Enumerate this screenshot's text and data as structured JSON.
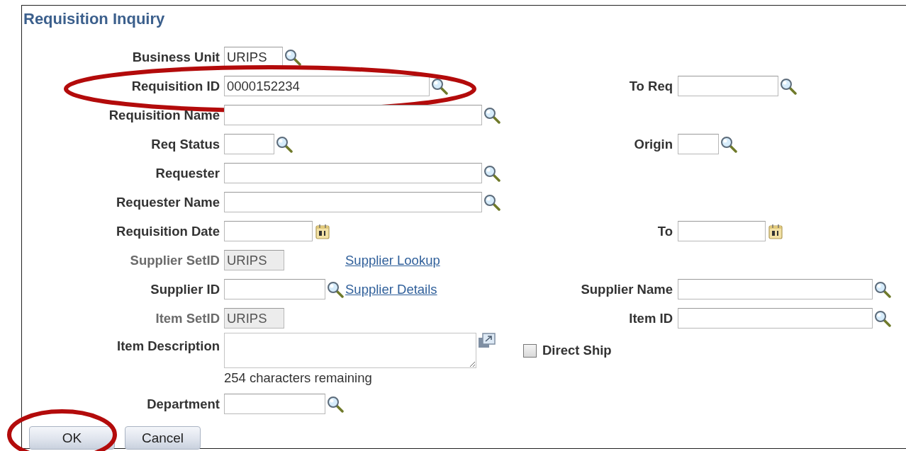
{
  "title": "Requisition Inquiry",
  "rows": [
    {
      "label": "Business Unit",
      "field": {
        "kind": "input",
        "value": "URIPS",
        "icon": {
          "kind": "search"
        }
      }
    },
    {
      "label": "Requisition ID",
      "circled": true,
      "field": {
        "kind": "input",
        "value": "0000152234",
        "icon": {
          "kind": "search"
        }
      },
      "right": {
        "kind": "input",
        "label": "To Req",
        "icon": {
          "kind": "search"
        }
      }
    },
    {
      "label": "Requisition Name",
      "field": {
        "kind": "input",
        "icon": {
          "kind": "search"
        }
      }
    },
    {
      "label": "Req Status",
      "field": {
        "kind": "input",
        "icon": {
          "kind": "search"
        }
      },
      "right": {
        "kind": "input",
        "label": "Origin",
        "icon": {
          "kind": "search"
        }
      }
    },
    {
      "label": "Requester",
      "field": {
        "kind": "input",
        "icon": {
          "kind": "search"
        }
      }
    },
    {
      "label": "Requester Name",
      "field": {
        "kind": "input",
        "icon": {
          "kind": "search"
        }
      }
    },
    {
      "label": "Requisition Date",
      "field": {
        "kind": "input",
        "icon": {
          "kind": "calendar"
        }
      },
      "right": {
        "kind": "input",
        "label": "To",
        "icon": {
          "kind": "calendar"
        }
      }
    },
    {
      "label": "Supplier SetID",
      "disabled": true,
      "field": {
        "kind": "input",
        "value": "URIPS",
        "disabled": true
      },
      "link": "Supplier Lookup"
    },
    {
      "label": "Supplier ID",
      "field": {
        "kind": "input",
        "icon": {
          "kind": "search"
        }
      },
      "link": "Supplier Details",
      "right": {
        "kind": "input",
        "label": "Supplier Name",
        "icon": {
          "kind": "search"
        }
      }
    },
    {
      "label": "Item SetID",
      "disabled": true,
      "field": {
        "kind": "input",
        "value": "URIPS",
        "disabled": true
      },
      "right": {
        "kind": "input",
        "label": "Item ID",
        "icon": {
          "kind": "search"
        }
      }
    },
    {
      "label": "Item Description",
      "field": {
        "kind": "textarea",
        "note": "254 characters remaining"
      },
      "right": {
        "kind": "checkbox",
        "label": "Direct Ship",
        "checked": false
      }
    },
    {
      "label": "Department",
      "field": {
        "kind": "input",
        "icon": {
          "kind": "search"
        }
      }
    }
  ],
  "buttons": [
    {
      "label": "OK",
      "circled": true
    },
    {
      "label": "Cancel",
      "circled": false
    }
  ]
}
